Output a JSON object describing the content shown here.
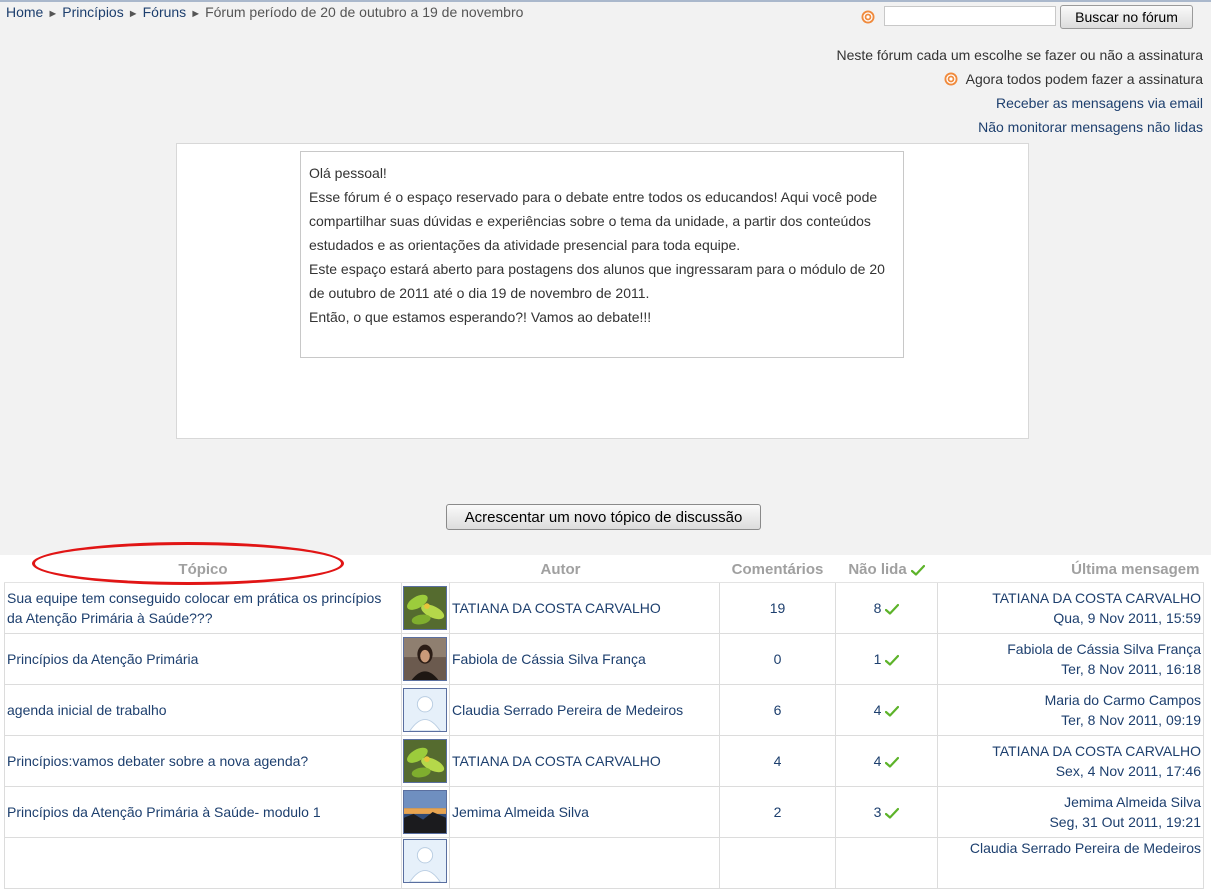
{
  "breadcrumb": {
    "home": "Home",
    "course": "Princípios",
    "forums": "Fóruns",
    "current": "Fórum período de 20 de outubro a 19 de novembro",
    "separator": "►"
  },
  "search": {
    "input_value": "",
    "button_label": "Buscar no fórum"
  },
  "subscription": {
    "mode_text": "Neste fórum cada um escolhe se fazer ou não a assinatura",
    "everyone_text": "Agora todos podem fazer a assinatura",
    "email_link": "Receber as mensagens via email",
    "track_link": "Não monitorar mensagens não lidas"
  },
  "intro": {
    "lines": [
      "Olá pessoal!",
      "Esse fórum é o espaço reservado para o debate entre todos os educandos! Aqui você pode compartilhar suas dúvidas e experiências sobre o tema da unidade, a partir dos conteúdos estudados e as orientações da atividade presencial para toda equipe.",
      "Este espaço estará aberto para postagens dos alunos que ingressaram para o módulo de 20 de outubro de 2011 até o dia 19 de novembro de 2011.",
      "Então, o que estamos esperando?! Vamos ao debate!!!"
    ]
  },
  "add_topic_button": "Acrescentar um novo tópico de discussão",
  "table": {
    "headers": {
      "topic": "Tópico",
      "author": "Autor",
      "replies": "Comentários",
      "unread": "Não lida",
      "last_post": "Última mensagem"
    },
    "rows": [
      {
        "topic": "Sua equipe tem conseguido colocar em prática os princípios da Atenção Primária à Saúde???",
        "avatar": "green-leaves",
        "author": "TATIANA DA COSTA CARVALHO",
        "replies": "19",
        "unread": "8",
        "last_author": "TATIANA DA COSTA CARVALHO",
        "last_date": "Qua, 9 Nov 2011, 15:59"
      },
      {
        "topic": "Princípios da Atenção Primária",
        "avatar": "portrait",
        "author": "Fabiola de Cássia Silva França",
        "replies": "0",
        "unread": "1",
        "last_author": "Fabiola de Cássia Silva França",
        "last_date": "Ter, 8 Nov 2011, 16:18"
      },
      {
        "topic": "agenda inicial de trabalho",
        "avatar": "default-user",
        "author": "Claudia Serrado Pereira de Medeiros",
        "replies": "6",
        "unread": "4",
        "last_author": "Maria do Carmo Campos",
        "last_date": "Ter, 8 Nov 2011, 09:19"
      },
      {
        "topic": "Princípios:vamos debater sobre a nova agenda?",
        "avatar": "green-leaves",
        "author": "TATIANA DA COSTA CARVALHO",
        "replies": "4",
        "unread": "4",
        "last_author": "TATIANA DA COSTA CARVALHO",
        "last_date": "Sex, 4 Nov 2011, 17:46"
      },
      {
        "topic": "Princípios da Atenção Primária à Saúde- modulo 1",
        "avatar": "sunset",
        "author": "Jemima Almeida Silva",
        "replies": "2",
        "unread": "3",
        "last_author": "Jemima Almeida Silva",
        "last_date": "Seg, 31 Out 2011, 19:21"
      },
      {
        "topic": "",
        "avatar": "default-user",
        "author": "",
        "replies": "",
        "unread": "",
        "last_author": "Claudia Serrado Pereira de Medeiros",
        "last_date": ""
      }
    ]
  },
  "colors": {
    "link": "#1d3f6e",
    "header_text": "#a0a0a0",
    "highlight_circle": "#e11515",
    "rss_orange": "#f08a3c",
    "check_green": "#5db32a"
  },
  "icons": {
    "rss": "rss-icon",
    "unread_check": "check-icon"
  }
}
